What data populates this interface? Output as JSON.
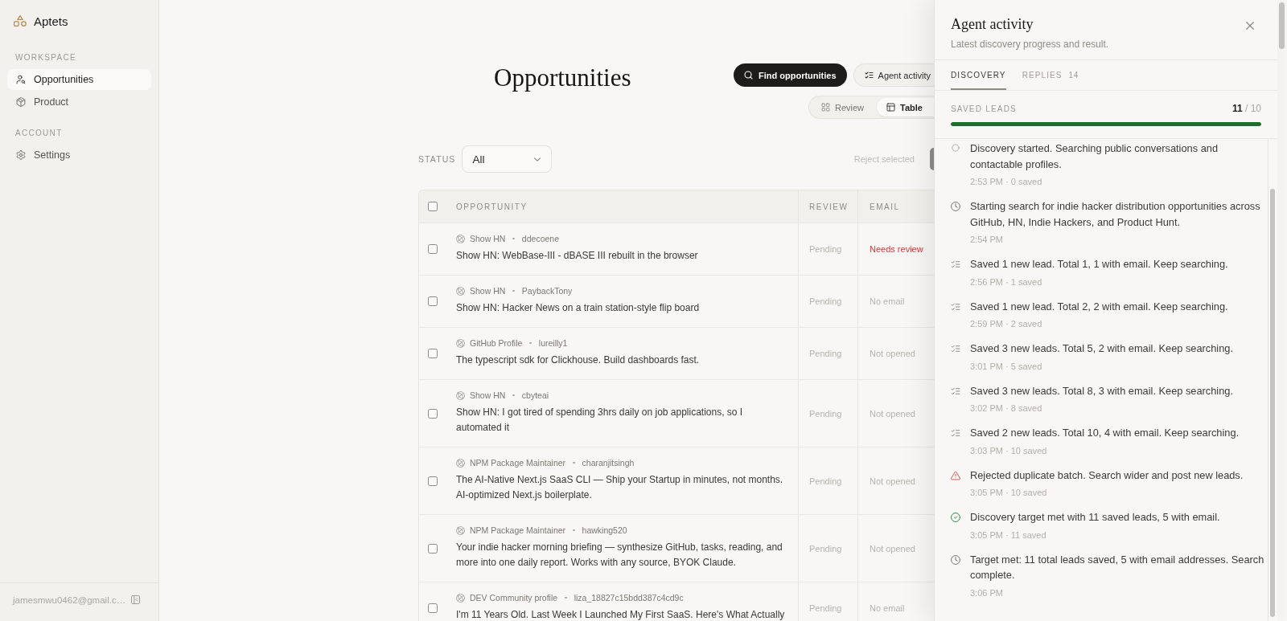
{
  "sidebar": {
    "brand": "Aptets",
    "sections": [
      {
        "heading": "WORKSPACE",
        "items": [
          {
            "label": "Opportunities",
            "selected": true
          },
          {
            "label": "Product",
            "selected": false
          }
        ]
      },
      {
        "heading": "ACCOUNT",
        "items": [
          {
            "label": "Settings",
            "selected": false
          }
        ]
      }
    ],
    "account_email": "jamesmwu0462@gmail.c…"
  },
  "header": {
    "title": "Opportunities",
    "actions": [
      {
        "label": "Find opportunities",
        "kind": "primary"
      },
      {
        "label": "Agent activity",
        "kind": "secondary"
      }
    ],
    "view_switch": [
      {
        "label": "Review",
        "selected": false
      },
      {
        "label": "Table",
        "selected": true
      }
    ]
  },
  "filters": {
    "label": "STATUS",
    "status_select": {
      "value": "All"
    },
    "bulk_action": {
      "label": "Reject selected",
      "disabled": true
    }
  },
  "table": {
    "select_all": {
      "checked": false
    },
    "columns": [
      "OPPORTUNITY",
      "REVIEW",
      "EMAIL"
    ],
    "rows": [
      {
        "checked": false,
        "source": "Show HN",
        "author": "ddecoene",
        "title": "Show HN: WebBase-III - dBASE III rebuilt in the browser",
        "review": "Pending",
        "email": {
          "text": "Needs review",
          "kind": "alert"
        }
      },
      {
        "checked": false,
        "source": "Show HN",
        "author": "PaybackTony",
        "title": "Show HN: Hacker News on a train station-style flip board",
        "review": "Pending",
        "email": {
          "text": "No email",
          "kind": "neutral"
        }
      },
      {
        "checked": false,
        "source": "GitHub Profile",
        "author": "lureilly1",
        "title": "The typescript sdk for Clickhouse. Build dashboards fast.",
        "review": "Pending",
        "email": {
          "text": "Not opened",
          "kind": "neutral"
        }
      },
      {
        "checked": false,
        "source": "Show HN",
        "author": "cbyteai",
        "title": "Show HN: I got tired of spending 3hrs daily on job applications, so I automated it",
        "review": "Pending",
        "email": {
          "text": "Not opened",
          "kind": "neutral"
        }
      },
      {
        "checked": false,
        "source": "NPM Package Maintainer",
        "author": "charanjitsingh",
        "title": "The AI-Native Next.js SaaS CLI — Ship your Startup in minutes, not months. AI-optimized Next.js boilerplate.",
        "review": "Pending",
        "email": {
          "text": "Not opened",
          "kind": "neutral"
        }
      },
      {
        "checked": false,
        "source": "NPM Package Maintainer",
        "author": "hawking520",
        "title": "Your indie hacker morning briefing — synthesize GitHub, tasks, reading, and more into one daily report. Works with any source, BYOK Claude.",
        "review": "Pending",
        "email": {
          "text": "Not opened",
          "kind": "neutral"
        }
      },
      {
        "checked": false,
        "source": "DEV Community profile",
        "author": "liza_18827c15bdd387c4cd9c",
        "title": "I'm 11 Years Old. Last Week I Launched My First SaaS. Here's What Actually",
        "review": "Pending",
        "email": {
          "text": "No email",
          "kind": "neutral"
        }
      }
    ]
  },
  "activity_panel": {
    "title": "Agent activity",
    "subtitle": "Latest discovery progress and result.",
    "tabs": [
      {
        "label": "DISCOVERY",
        "selected": true
      },
      {
        "label": "REPLIES",
        "count": "14",
        "selected": false
      }
    ],
    "saved_leads": {
      "label": "SAVED LEADS",
      "value": "**11** / 10",
      "level": 1
    },
    "events": [
      {
        "kind": "started",
        "message": "Discovery started. Searching public conversations and contactable profiles.",
        "meta": "2:53 PM · 0 saved"
      },
      {
        "kind": "message",
        "message": "Starting search for indie hacker distribution opportunities across GitHub, HN, Indie Hackers, and Product Hunt.",
        "meta": "2:54 PM"
      },
      {
        "kind": "saved",
        "message": "Saved 1 new lead. Total 1, 1 with email. Keep searching.",
        "meta": "2:56 PM · 1 saved"
      },
      {
        "kind": "saved",
        "message": "Saved 1 new lead. Total 2, 2 with email. Keep searching.",
        "meta": "2:59 PM · 2 saved"
      },
      {
        "kind": "saved",
        "message": "Saved 3 new leads. Total 5, 2 with email. Keep searching.",
        "meta": "3:01 PM · 5 saved"
      },
      {
        "kind": "saved",
        "message": "Saved 3 new leads. Total 8, 3 with email. Keep searching.",
        "meta": "3:02 PM · 8 saved"
      },
      {
        "kind": "saved",
        "message": "Saved 2 new leads. Total 10, 4 with email. Keep searching.",
        "meta": "3:03 PM · 10 saved"
      },
      {
        "kind": "rejected",
        "message": "Rejected duplicate batch. Search wider and post new leads.",
        "meta": "3:05 PM · 10 saved"
      },
      {
        "kind": "completed",
        "message": "Discovery target met with 11 saved leads, 5 with email.",
        "meta": "3:05 PM · 11 saved"
      },
      {
        "kind": "message",
        "message": "Target met: 11 total leads saved, 5 with email addresses. Search complete.",
        "meta": "3:06 PM"
      }
    ]
  }
}
